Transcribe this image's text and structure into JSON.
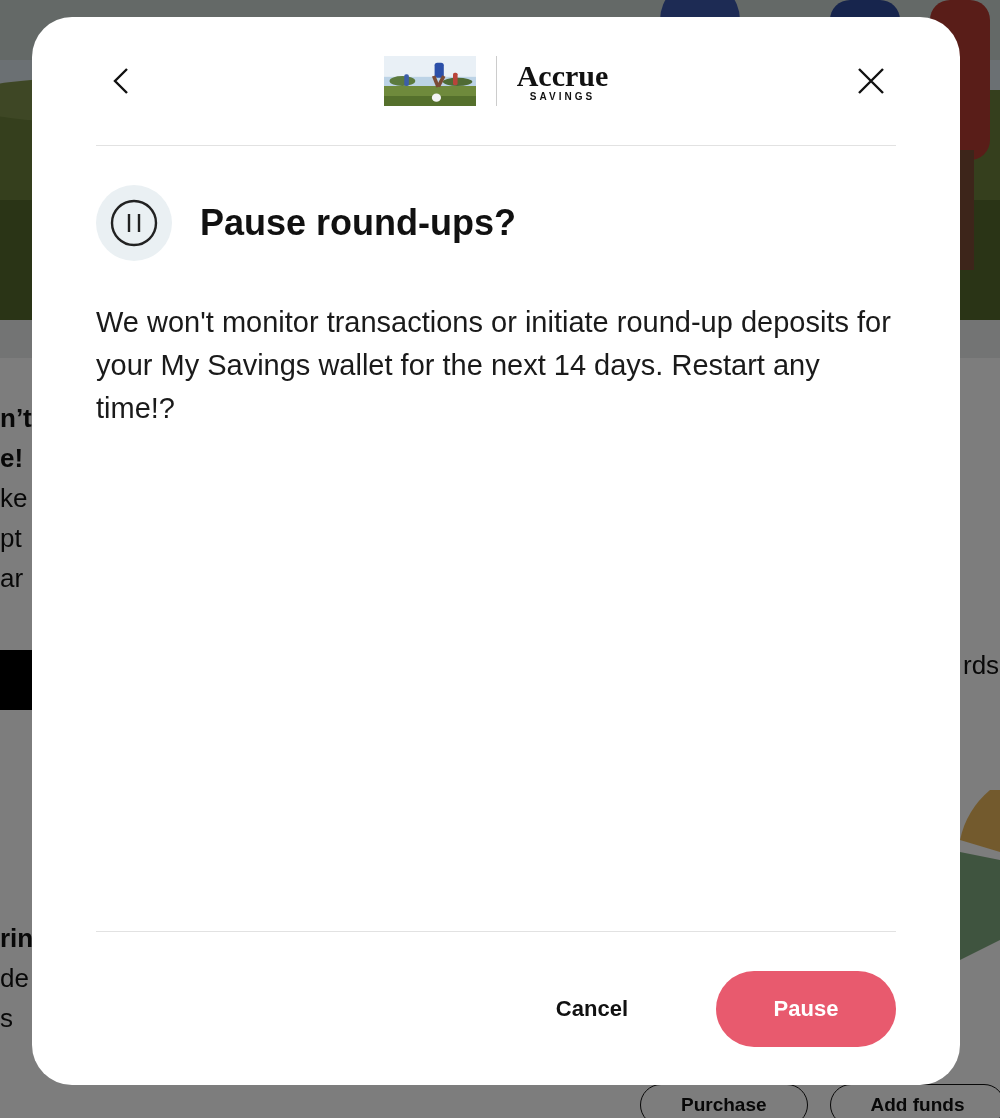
{
  "background": {
    "left_texts": [
      {
        "text": "n’t",
        "kind": "heading"
      },
      {
        "text": "e!",
        "kind": "heading"
      },
      {
        "text": "ke",
        "kind": "body"
      },
      {
        "text": "pt",
        "kind": "body"
      },
      {
        "text": "ar",
        "kind": "body"
      },
      {
        "text": "rin",
        "kind": "heading"
      },
      {
        "text": "de",
        "kind": "body"
      },
      {
        "text": "s",
        "kind": "body"
      }
    ],
    "right_text": "rds",
    "buttons": [
      "Purchase",
      "Add funds"
    ]
  },
  "dialog": {
    "brand": {
      "name": "Accrue",
      "tagline": "SAVINGS"
    },
    "title": "Pause round-ups?",
    "message": "We won't monitor transactions or initiate round-up deposits for your My Savings wallet for the next 14 days. Restart any time!?",
    "buttons": [
      {
        "label": "Cancel",
        "kind": "text"
      },
      {
        "label": "Pause",
        "kind": "primary"
      }
    ]
  }
}
